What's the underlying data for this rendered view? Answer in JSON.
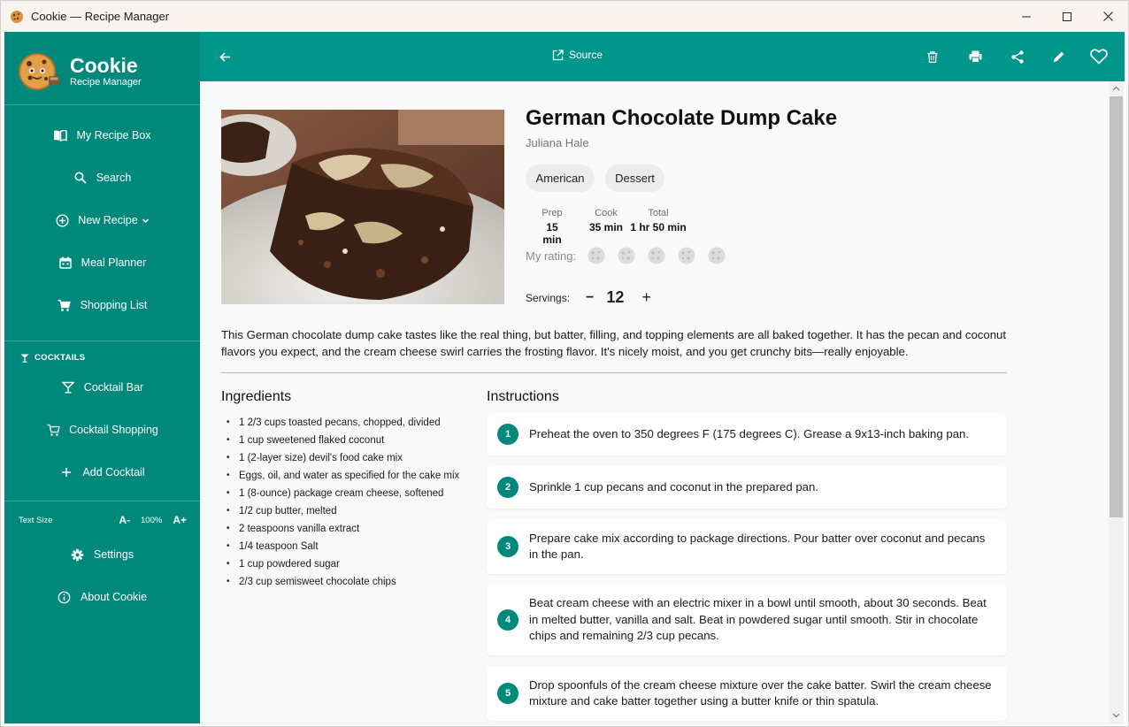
{
  "window": {
    "title": "Cookie — Recipe Manager"
  },
  "brand": {
    "name": "Cookie",
    "subtitle": "Recipe Manager"
  },
  "sidebar": {
    "items": [
      {
        "label": "My Recipe Box",
        "icon": "book-icon"
      },
      {
        "label": "Search",
        "icon": "search-icon"
      },
      {
        "label": "New Recipe",
        "icon": "add-circle-icon"
      },
      {
        "label": "Meal Planner",
        "icon": "calendar-icon"
      },
      {
        "label": "Shopping List",
        "icon": "cart-icon"
      }
    ],
    "cocktails_label": "COCKTAILS",
    "cocktail_items": [
      {
        "label": "Cocktail Bar",
        "icon": "cocktail-icon"
      },
      {
        "label": "Cocktail Shopping",
        "icon": "cart-icon"
      },
      {
        "label": "Add Cocktail",
        "icon": "plus-icon"
      }
    ],
    "text_size": {
      "label": "Text Size",
      "decrease": "A-",
      "value": "100%",
      "increase": "A+"
    },
    "footer_items": [
      {
        "label": "Settings",
        "icon": "gear-icon"
      },
      {
        "label": "About Cookie",
        "icon": "info-icon"
      }
    ]
  },
  "appbar": {
    "source_label": "Source"
  },
  "recipe": {
    "title": "German Chocolate Dump Cake",
    "author": "Juliana Hale",
    "tags": [
      "American",
      "Dessert"
    ],
    "times": [
      {
        "label": "Prep",
        "value": "15 min"
      },
      {
        "label": "Cook",
        "value": "35 min"
      },
      {
        "label": "Total",
        "value": "1 hr 50 min"
      }
    ],
    "rating_label": "My rating:",
    "rating": 0,
    "rating_max": 5,
    "servings_label": "Servings:",
    "servings": "12",
    "decrease": "−",
    "increase": "+",
    "description": "This German chocolate dump cake tastes like the real thing, but batter, filling, and topping elements are all baked together. It has the pecan and coconut flavors you expect, and the cream cheese swirl carries the frosting flavor. It's nicely moist, and you get crunchy bits—really enjoyable.",
    "ingredients_title": "Ingredients",
    "ingredients": [
      "1 2/3 cups toasted pecans, chopped, divided",
      "1 cup sweetened flaked coconut",
      "1 (2-layer size) devil's food cake mix",
      "Eggs, oil, and water as specified for the cake mix",
      "1 (8-ounce) package cream cheese, softened",
      "1/2 cup butter, melted",
      "2 teaspoons vanilla extract",
      "1/4 teaspoon Salt",
      "1 cup powdered sugar",
      "2/3 cup semisweet chocolate chips"
    ],
    "instructions_title": "Instructions",
    "instructions": [
      {
        "n": "1",
        "text": "Preheat the oven to 350 degrees F (175 degrees C). Grease a 9x13-inch baking pan."
      },
      {
        "n": "2",
        "text": "Sprinkle 1 cup pecans and coconut in the prepared pan."
      },
      {
        "n": "3",
        "text": "Prepare cake mix according to package directions. Pour batter over coconut and pecans in the pan."
      },
      {
        "n": "4",
        "text": "Beat cream cheese with an electric mixer in a bowl until smooth, about 30 seconds. Beat in melted butter, vanilla and salt. Beat in powdered sugar until smooth. Stir in chocolate chips and remaining 2/3 cup pecans."
      },
      {
        "n": "5",
        "text": "Drop spoonfuls of the cream cheese mixture over the cake batter. Swirl the cream cheese mixture and cake batter together using a butter knife or thin spatula."
      }
    ]
  },
  "colors": {
    "sidebar": "#00897b",
    "appbar": "#00968a",
    "accent": "#00897b",
    "content_bg": "#f9f9f9"
  }
}
